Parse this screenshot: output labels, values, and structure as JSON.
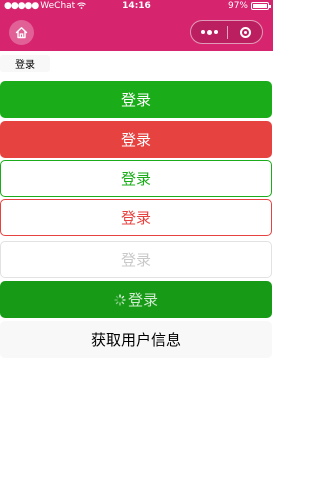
{
  "status_bar": {
    "carrier": "WeChat",
    "time": "14:16",
    "battery": "97%",
    "battery_level": 0.97
  },
  "nav_bar": {
    "home_icon": "home-icon",
    "capsule_more_icon": "more-dots-icon",
    "capsule_close_icon": "target-icon"
  },
  "buttons": {
    "mini": "登录",
    "primary": "登录",
    "warn": "登录",
    "plain_primary": "登录",
    "plain_warn": "登录",
    "disabled": "登录",
    "loading": "登录",
    "get_user_info": "获取用户信息"
  },
  "colors": {
    "nav": "#d6246e",
    "primary": "#1aad19",
    "warn": "#e64340",
    "disabled_text": "#c9c9c9"
  }
}
